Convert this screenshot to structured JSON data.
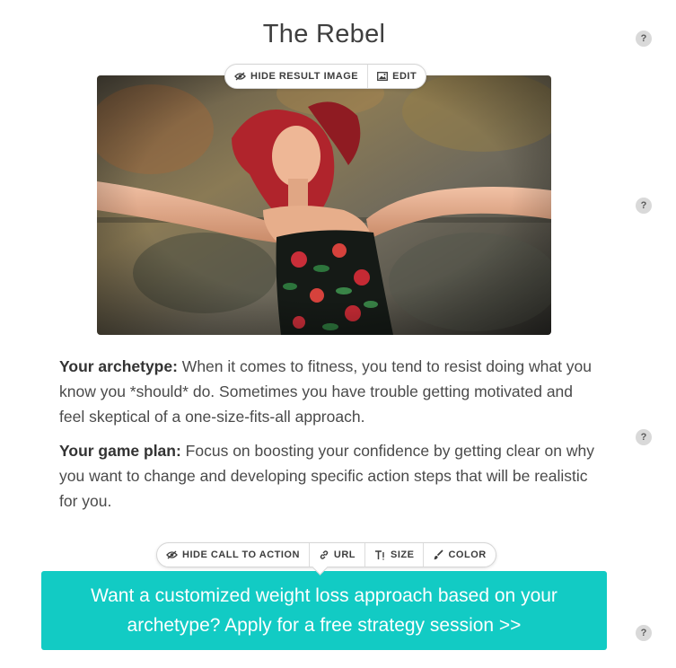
{
  "result": {
    "title": "The Rebel",
    "image_alt": "Woman with red hair, arms outstretched against a weathered wall"
  },
  "result_toolbar": {
    "hide_label": "HIDE RESULT IMAGE",
    "edit_label": "EDIT"
  },
  "description": {
    "archetype_label": "Your archetype:",
    "archetype_text": " When it comes to fitness, you tend to resist doing what you know you *should* do. Sometimes you have trouble getting motivated and feel skeptical of a one-size-fits-all approach.",
    "gameplan_label": "Your game plan:",
    "gameplan_text": " Focus on boosting your confidence by getting clear on why you want to change and developing specific action steps that will be realistic for you."
  },
  "cta_toolbar": {
    "hide_label": "HIDE CALL TO ACTION",
    "url_label": "URL",
    "size_label": "SIZE",
    "color_label": "COLOR"
  },
  "cta": {
    "label": "Want a customized weight loss approach based on your archetype? Apply for a free strategy session >>",
    "color": "#12cbc4"
  },
  "help_icons": [
    "?",
    "?",
    "?",
    "?"
  ]
}
